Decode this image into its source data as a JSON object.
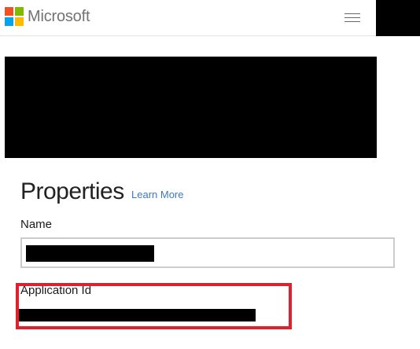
{
  "header": {
    "brand": "Microsoft",
    "logo_colors": [
      "#f25022",
      "#7fba00",
      "#00a4ef",
      "#ffb900"
    ],
    "menu_icon": "hamburger-menu-icon"
  },
  "properties": {
    "title": "Properties",
    "learn_more": "Learn More",
    "name_label": "Name",
    "app_id_label": "Application Id"
  },
  "colors": {
    "link": "#3a78c3",
    "highlight": "#e0202d",
    "brand_text": "#737373"
  }
}
